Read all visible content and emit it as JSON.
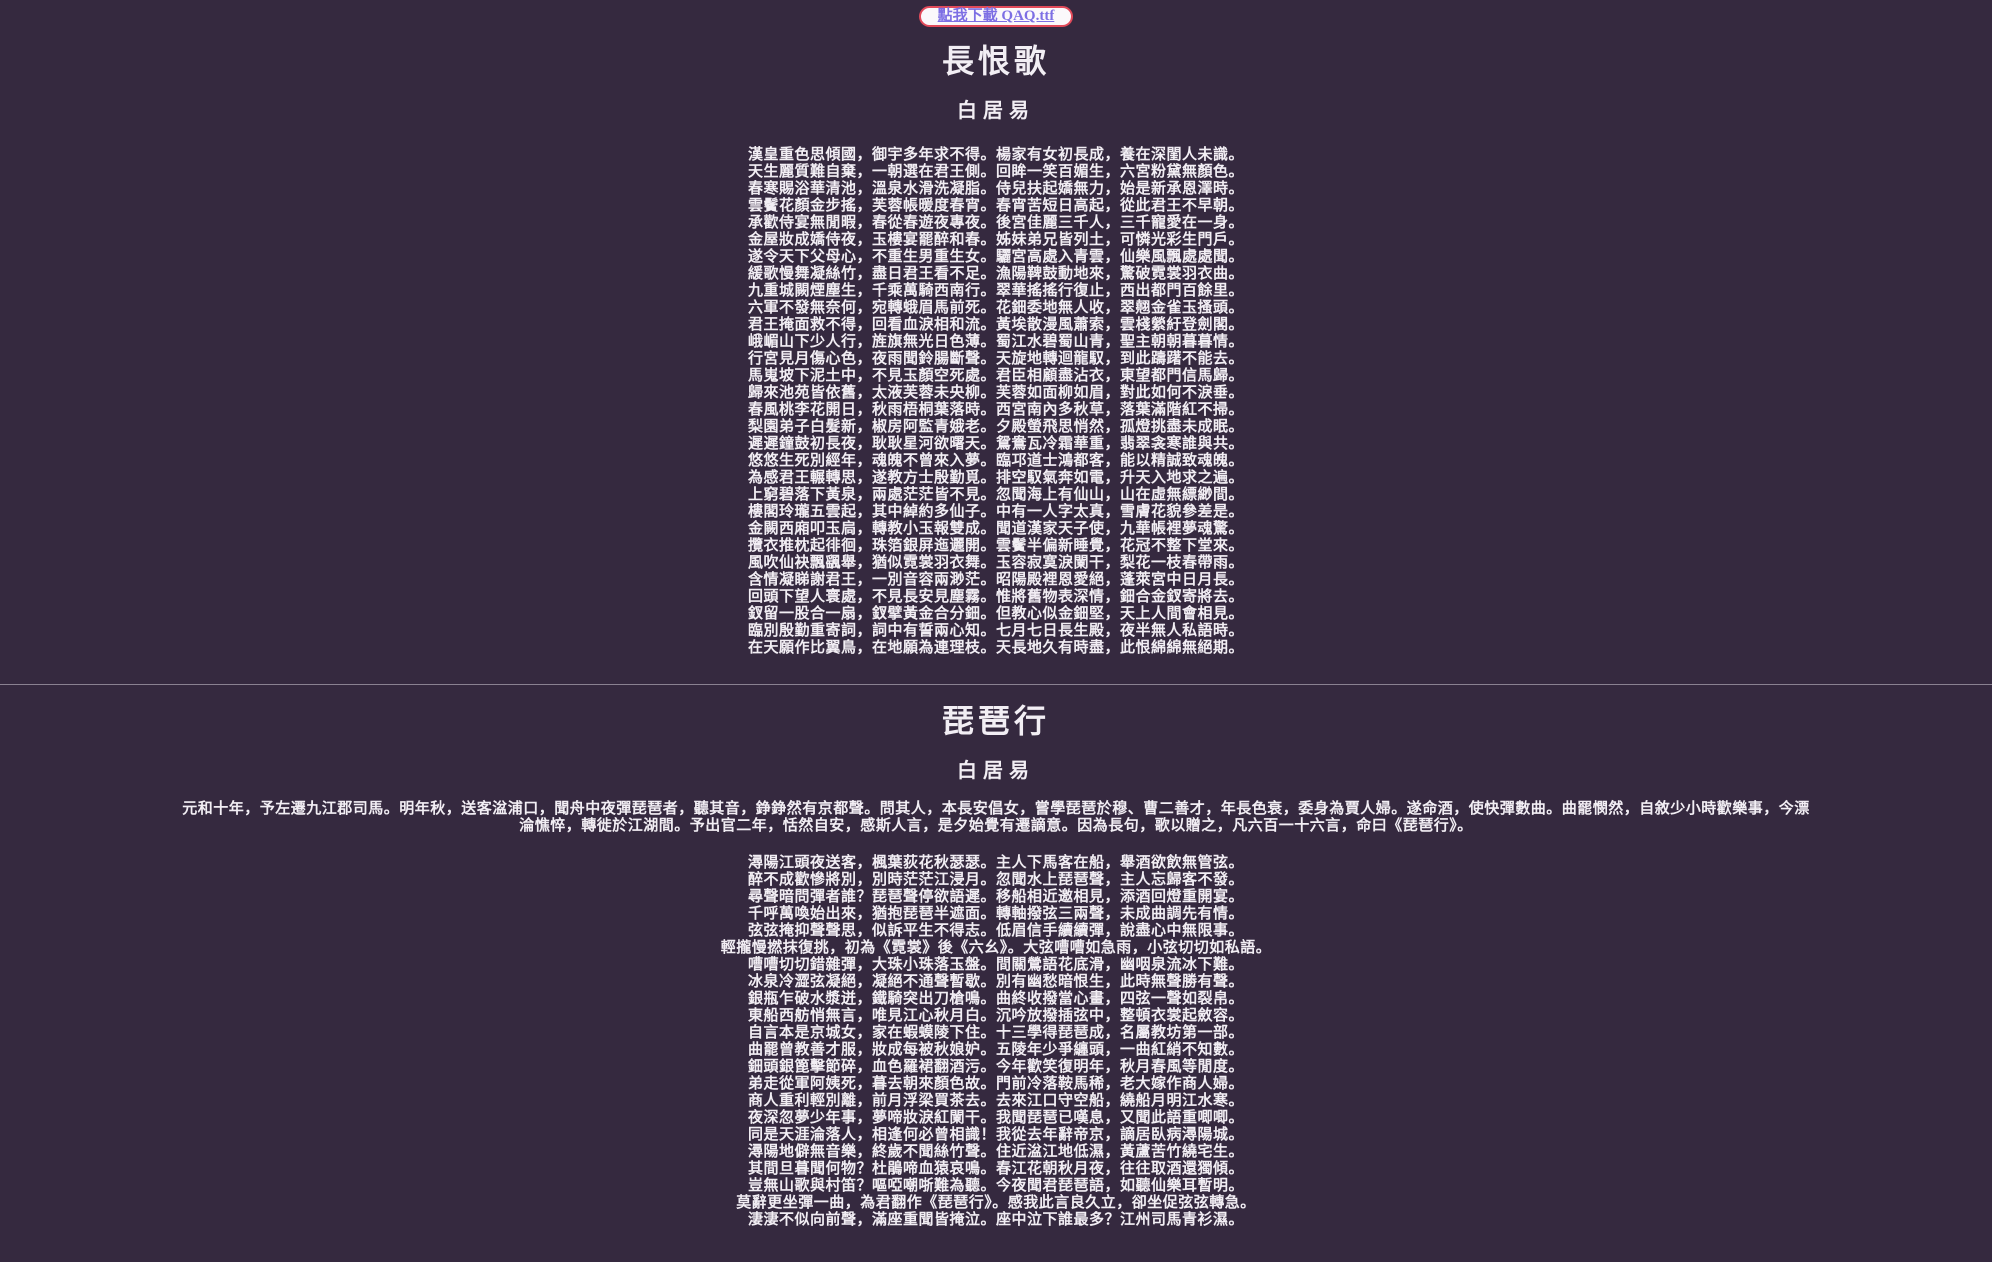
{
  "download": {
    "label": "點我下載 QAQ.ttf"
  },
  "poems": [
    {
      "title": "長恨歌",
      "author": "白居易",
      "lines": [
        "漢皇重色思傾國，御宇多年求不得。楊家有女初長成，養在深閨人未識。",
        "天生麗質難自棄，一朝選在君王側。回眸一笑百媚生，六宮粉黛無顏色。",
        "春寒賜浴華清池，溫泉水滑洗凝脂。侍兒扶起嬌無力，始是新承恩澤時。",
        "雲鬢花顏金步搖，芙蓉帳暖度春宵。春宵苦短日高起，從此君王不早朝。",
        "承歡侍宴無閒暇，春從春遊夜專夜。後宮佳麗三千人，三千寵愛在一身。",
        "金屋妝成嬌侍夜，玉樓宴罷醉和春。姊妹弟兄皆列土，可憐光彩生門戶。",
        "遂令天下父母心，不重生男重生女。驪宮高處入青雲，仙樂風飄處處聞。",
        "緩歌慢舞凝絲竹，盡日君王看不足。漁陽鞞鼓動地來，驚破霓裳羽衣曲。",
        "九重城闕煙塵生，千乘萬騎西南行。翠華搖搖行復止，西出都門百餘里。",
        "六軍不發無奈何，宛轉蛾眉馬前死。花鈿委地無人收，翠翹金雀玉搔頭。",
        "君王掩面救不得，回看血淚相和流。黃埃散漫風蕭索，雲棧縈紆登劍閣。",
        "峨嵋山下少人行，旌旗無光日色薄。蜀江水碧蜀山青，聖主朝朝暮暮情。",
        "行宮見月傷心色，夜雨聞鈴腸斷聲。天旋地轉迴龍馭，到此躊躇不能去。",
        "馬嵬坡下泥土中，不見玉顏空死處。君臣相顧盡沾衣，東望都門信馬歸。",
        "歸來池苑皆依舊，太液芙蓉未央柳。芙蓉如面柳如眉，對此如何不淚垂。",
        "春風桃李花開日，秋雨梧桐葉落時。西宮南內多秋草，落葉滿階紅不掃。",
        "梨園弟子白髮新，椒房阿監青娥老。夕殿螢飛思悄然，孤燈挑盡未成眠。",
        "遲遲鐘鼓初長夜，耿耿星河欲曙天。鴛鴦瓦冷霜華重，翡翠衾寒誰與共。",
        "悠悠生死別經年，魂魄不曾來入夢。臨邛道士鴻都客，能以精誠致魂魄。",
        "為感君王輾轉思，遂教方士殷勤覓。排空馭氣奔如電，升天入地求之遍。",
        "上窮碧落下黃泉，兩處茫茫皆不見。忽聞海上有仙山，山在虛無縹緲間。",
        "樓閣玲瓏五雲起，其中綽約多仙子。中有一人字太真，雪膚花貌參差是。",
        "金闕西廂叩玉扃，轉教小玉報雙成。聞道漢家天子使，九華帳裡夢魂驚。",
        "攬衣推枕起徘徊，珠箔銀屏迤邐開。雲鬢半偏新睡覺，花冠不整下堂來。",
        "風吹仙袂飄颻舉，猶似霓裳羽衣舞。玉容寂寞淚闌干，梨花一枝春帶雨。",
        "含情凝睇謝君王，一別音容兩渺茫。昭陽殿裡恩愛絕，蓬萊宮中日月長。",
        "回頭下望人寰處，不見長安見塵霧。惟將舊物表深情，鈿合金釵寄將去。",
        "釵留一股合一扇，釵擘黃金合分鈿。但教心似金鈿堅，天上人間會相見。",
        "臨別殷勤重寄詞，詞中有誓兩心知。七月七日長生殿，夜半無人私語時。",
        "在天願作比翼鳥，在地願為連理枝。天長地久有時盡，此恨綿綿無絕期。"
      ]
    },
    {
      "title": "琵琶行",
      "author": "白居易",
      "preface": "元和十年，予左遷九江郡司馬。明年秋，送客湓浦口，聞舟中夜彈琵琶者，聽其音，錚錚然有京都聲。問其人，本長安倡女，嘗學琵琶於穆、曹二善才，年長色衰，委身為賈人婦。遂命酒，使快彈數曲。曲罷憫然，自敘少小時歡樂事，今漂淪憔悴，轉徙於江湖間。予出官二年，恬然自安，感斯人言，是夕始覺有遷謫意。因為長句，歌以贈之，凡六百一十六言，命曰《琵琶行》。",
      "lines": [
        "潯陽江頭夜送客，楓葉荻花秋瑟瑟。主人下馬客在船，舉酒欲飲無管弦。",
        "醉不成歡慘將別，別時茫茫江浸月。忽聞水上琵琶聲，主人忘歸客不發。",
        "尋聲暗問彈者誰？琵琶聲停欲語遲。移船相近邀相見，添酒回燈重開宴。",
        "千呼萬喚始出來，猶抱琵琶半遮面。轉軸撥弦三兩聲，未成曲調先有情。",
        "弦弦掩抑聲聲思，似訴平生不得志。低眉信手續續彈，說盡心中無限事。",
        "輕攏慢撚抹復挑，初為《霓裳》後《六幺》。大弦嘈嘈如急雨，小弦切切如私語。",
        "嘈嘈切切錯雜彈，大珠小珠落玉盤。間關鶯語花底滑，幽咽泉流冰下難。",
        "冰泉冷澀弦凝絕，凝絕不通聲暫歇。別有幽愁暗恨生，此時無聲勝有聲。",
        "銀瓶乍破水漿迸，鐵騎突出刀槍鳴。曲終收撥當心畫，四弦一聲如裂帛。",
        "東船西舫悄無言，唯見江心秋月白。沉吟放撥插弦中，整頓衣裳起斂容。",
        "自言本是京城女，家在蝦蟆陵下住。十三學得琵琶成，名屬教坊第一部。",
        "曲罷曾教善才服，妝成每被秋娘妒。五陵年少爭纏頭，一曲紅綃不知數。",
        "鈿頭銀篦擊節碎，血色羅裙翻酒污。今年歡笑復明年，秋月春風等閒度。",
        "弟走從軍阿姨死，暮去朝來顏色故。門前冷落鞍馬稀，老大嫁作商人婦。",
        "商人重利輕別離，前月浮梁買茶去。去來江口守空船，繞船月明江水寒。",
        "夜深忽夢少年事，夢啼妝淚紅闌干。我聞琵琶已嘆息，又聞此語重唧唧。",
        "同是天涯淪落人，相逢何必曾相識！我從去年辭帝京，謫居臥病潯陽城。",
        "潯陽地僻無音樂，終歲不聞絲竹聲。住近湓江地低濕，黃蘆苦竹繞宅生。",
        "其間旦暮聞何物？杜鵑啼血猿哀鳴。春江花朝秋月夜，往往取酒還獨傾。",
        "豈無山歌與村笛？嘔啞嘲哳難為聽。今夜聞君琵琶語，如聽仙樂耳暫明。",
        "莫辭更坐彈一曲，為君翻作《琵琶行》。感我此言良久立，卻坐促弦弦轉急。",
        "淒淒不似向前聲，滿座重聞皆掩泣。座中泣下誰最多？江州司馬青衫濕。"
      ]
    }
  ]
}
